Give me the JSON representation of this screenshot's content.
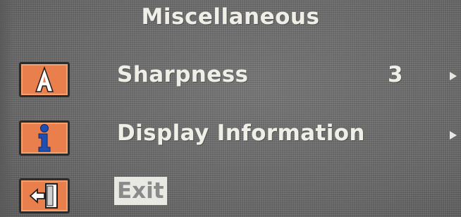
{
  "menu": {
    "title": "Miscellaneous",
    "items": [
      {
        "label": "Sharpness",
        "value": "3",
        "icon": "letter-a-icon",
        "has_arrow": true
      },
      {
        "label": "Display Information",
        "value": "",
        "icon": "info-icon",
        "has_arrow": true
      },
      {
        "label": "Exit",
        "value": "",
        "icon": "exit-door-icon",
        "has_arrow": false,
        "selected": true
      }
    ]
  },
  "colors": {
    "background": "#707070",
    "icon_fill": "#e97f4c",
    "text": "#efefe8",
    "selected_highlight": "#e9e9e4",
    "info_icon_blue": "#1f4fb3"
  }
}
